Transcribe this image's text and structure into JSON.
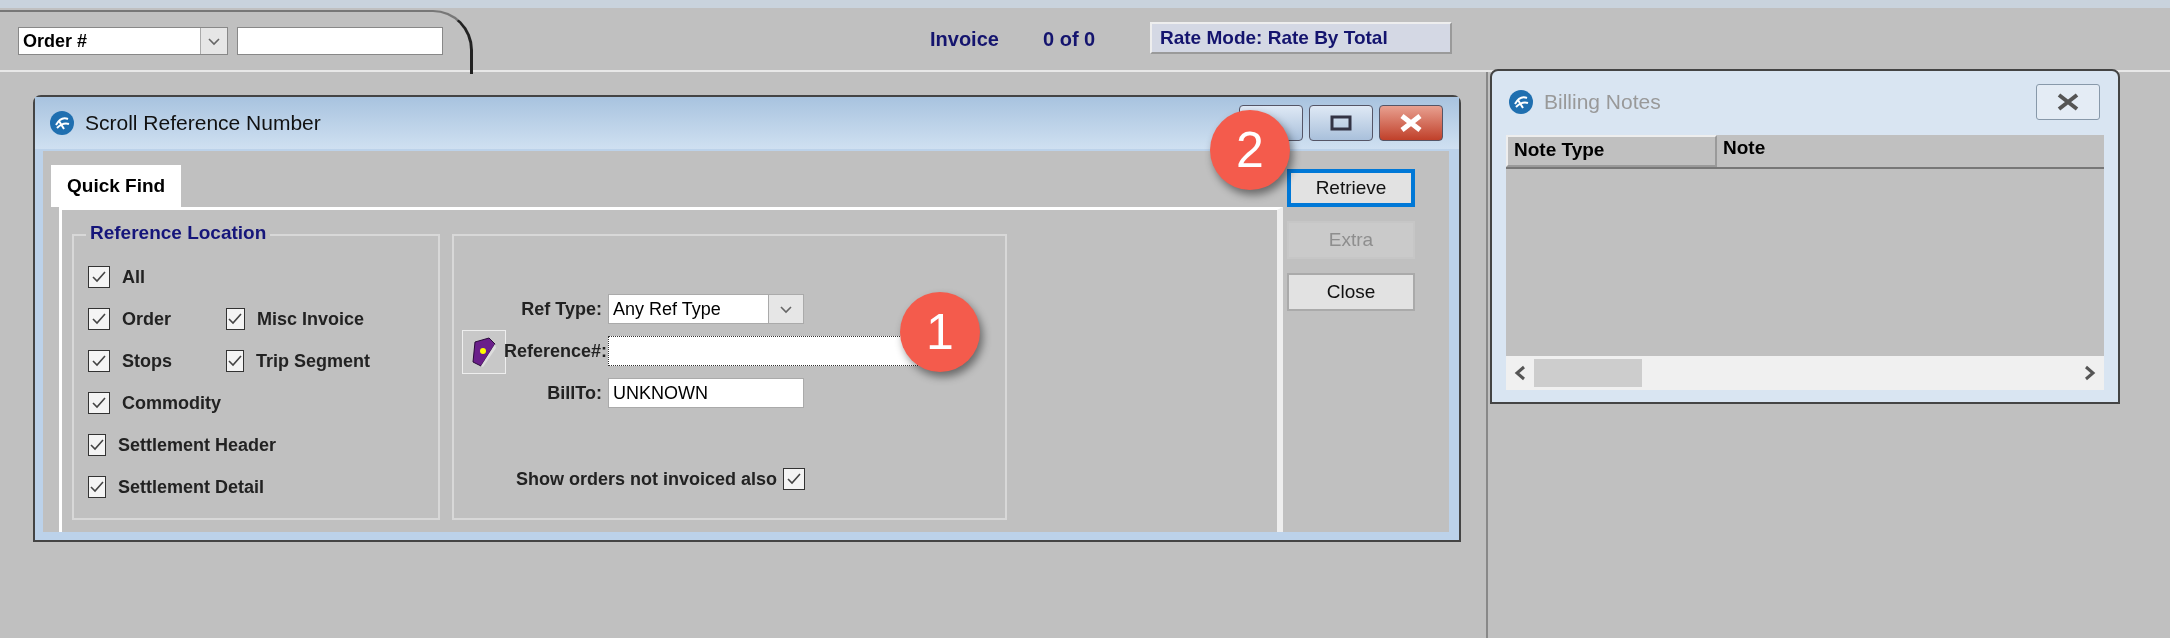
{
  "toolbar": {
    "search_by": "Order #",
    "invoice_label": "Invoice",
    "invoice_count": "0 of 0",
    "rate_mode_button": "Rate Mode: Rate By Total"
  },
  "dialog": {
    "title": "Scroll Reference Number",
    "tabs": [
      {
        "label": "Quick Find",
        "selected": true
      }
    ],
    "group_title": "Reference Location",
    "location_rows": [
      [
        {
          "label": "All",
          "checked": true
        }
      ],
      [
        {
          "label": "Order",
          "checked": true
        },
        {
          "label": "Misc Invoice",
          "checked": true
        }
      ],
      [
        {
          "label": "Stops",
          "checked": true
        },
        {
          "label": "Trip Segment",
          "checked": true
        }
      ],
      [
        {
          "label": "Commodity",
          "checked": true
        }
      ],
      [
        {
          "label": "Settlement Header",
          "checked": true
        }
      ],
      [
        {
          "label": "Settlement Detail",
          "checked": true
        }
      ]
    ],
    "ref_type_label": "Ref Type:",
    "ref_type_value": "Any Ref Type",
    "reference_label": "Reference#:",
    "billto_label": "BillTo:",
    "billto_value": "UNKNOWN",
    "show_not_invoiced": {
      "label": "Show orders not invoiced also",
      "checked": true
    },
    "buttons": [
      {
        "label": "Retrieve",
        "disabled": false,
        "focused": true
      },
      {
        "label": "Extra",
        "disabled": true,
        "focused": false
      },
      {
        "label": "Close",
        "disabled": false,
        "focused": false
      }
    ]
  },
  "callouts": [
    {
      "number": "1"
    },
    {
      "number": "2"
    }
  ],
  "billing_notes": {
    "title": "Billing Notes",
    "columns": [
      "Note Type",
      "Note"
    ]
  }
}
